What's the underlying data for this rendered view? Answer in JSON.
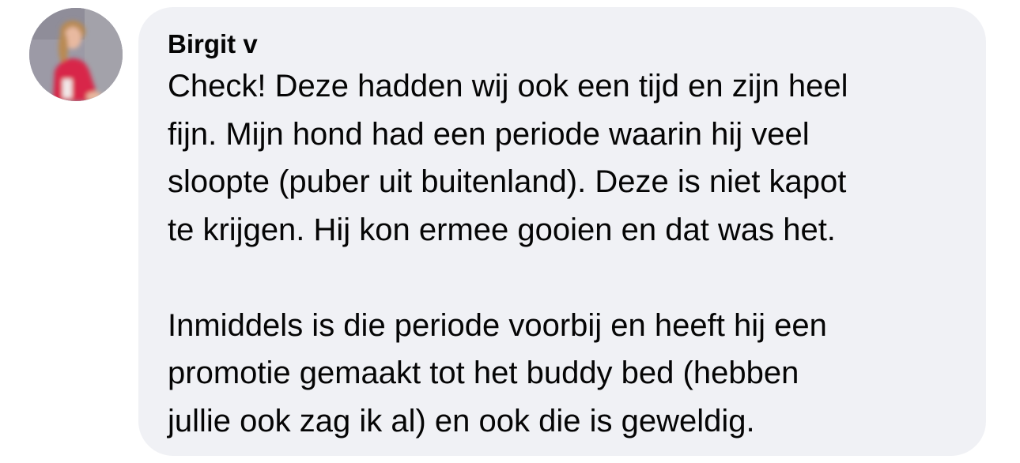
{
  "comment": {
    "author": "Birgit v",
    "paragraphs": [
      {
        "lines": [
          "Check! Deze hadden wij ook een tijd en zijn heel",
          "fijn. Mijn hond had een periode waarin hij veel",
          "sloopte (puber uit buitenland). Deze is niet kapot",
          "te krijgen. Hij kon ermee gooien en dat was het."
        ]
      },
      {
        "lines": [
          "Inmiddels is die periode voorbij en heeft hij een",
          "promotie gemaakt tot het buddy bed (hebben",
          "jullie ook zag ik al) en ook die is geweldig."
        ]
      }
    ]
  },
  "colors": {
    "bubble_background": "#f0f1f5",
    "text": "#050505"
  },
  "icons": {
    "avatar": "profile-photo"
  }
}
